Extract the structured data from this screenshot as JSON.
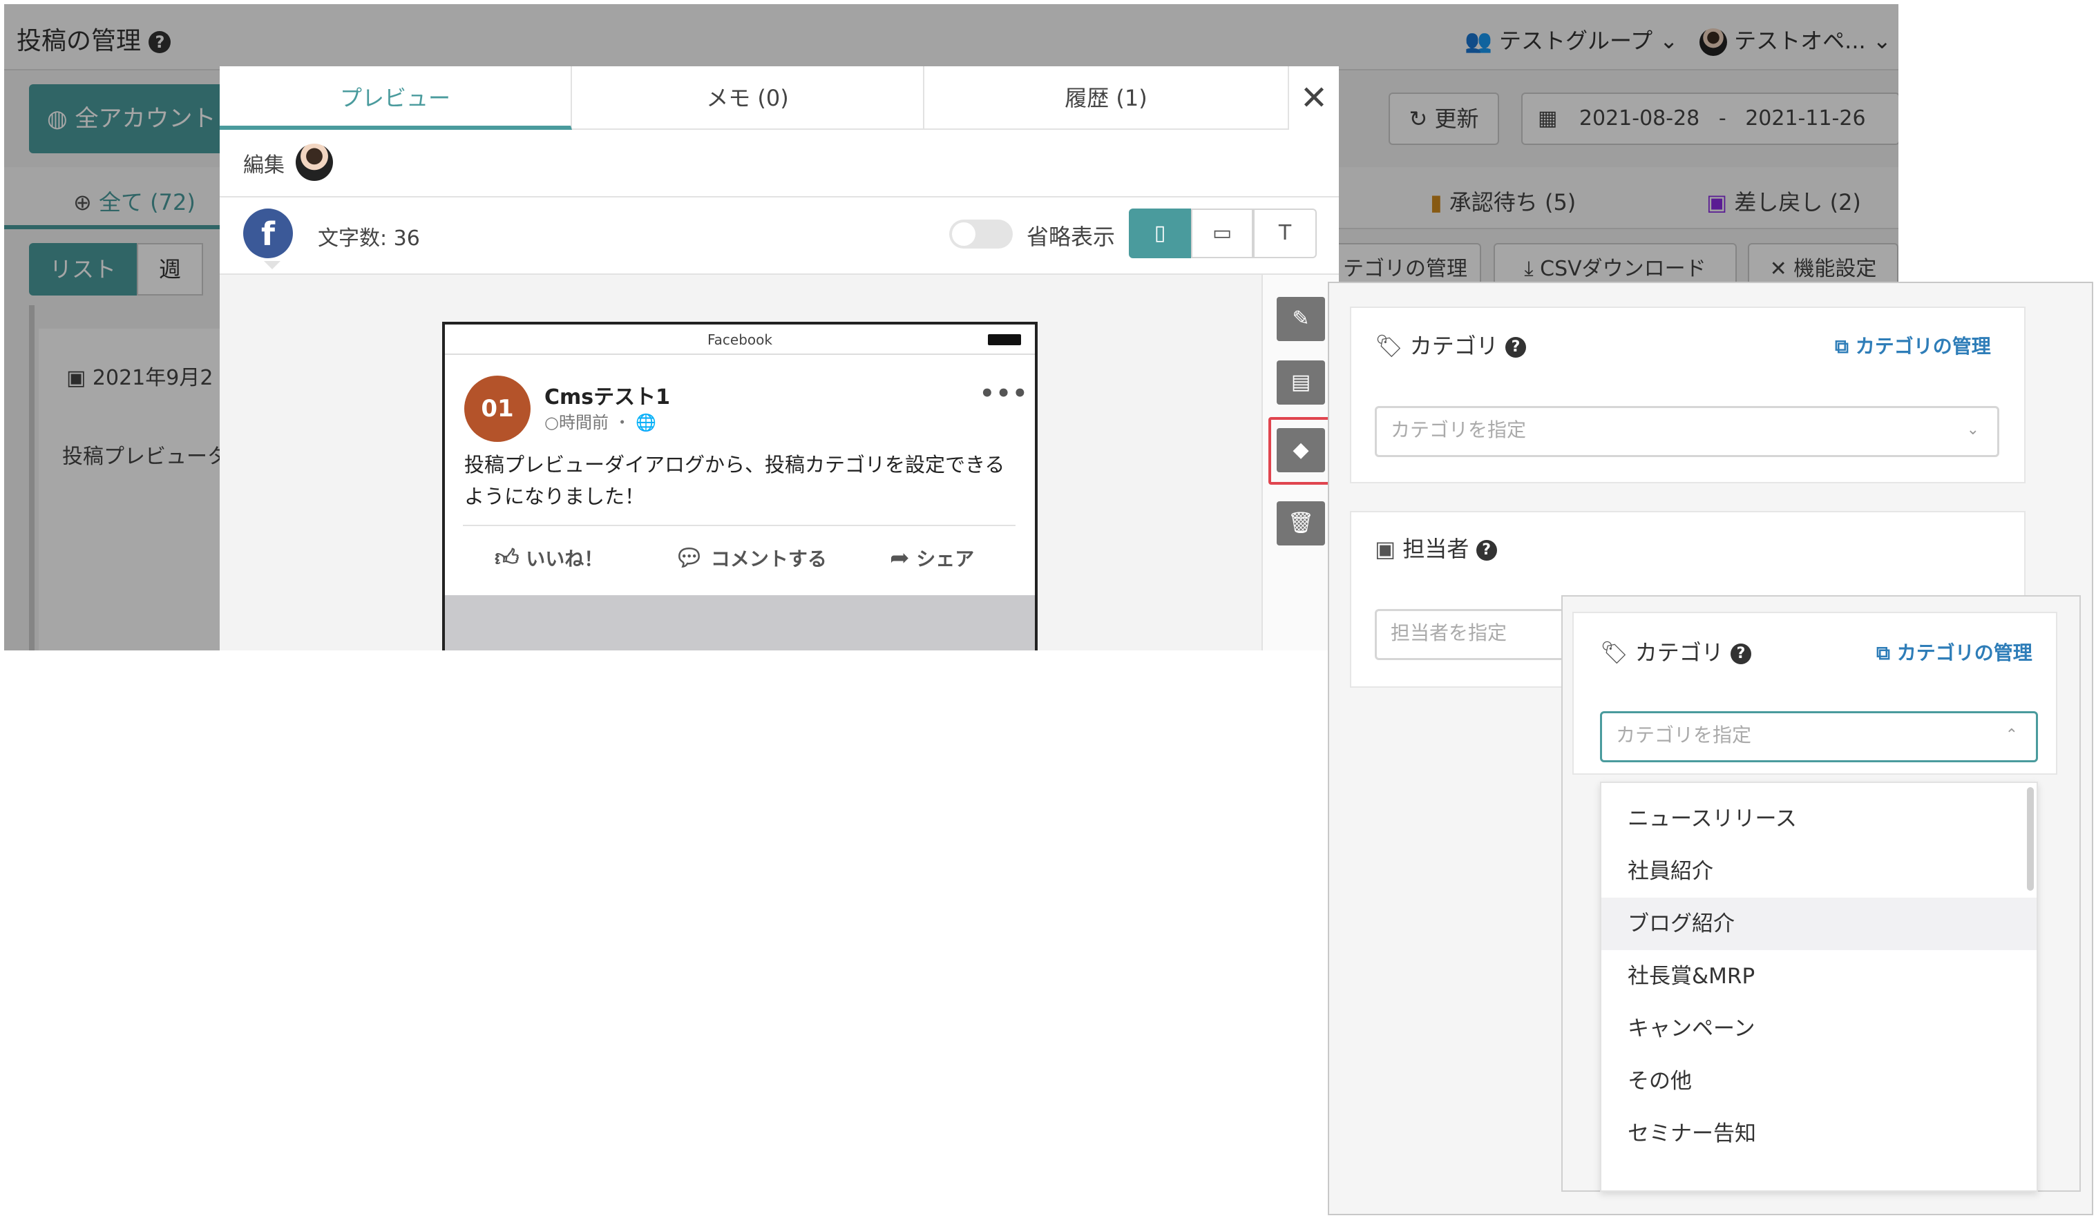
{
  "app": {
    "title": "投稿の管理",
    "group": "テストグループ",
    "user": "テストオペ...",
    "account_button": "全アカウント",
    "refresh": "更新",
    "date_from": "2021-08-28",
    "date_sep": "-",
    "date_to": "2021-11-26",
    "tab_all": "全て (72)",
    "tab_waiting": "承認待ち (5)",
    "tab_returned": "差し戻し (2)",
    "view_list": "リスト",
    "view_week": "週",
    "btn_category_manage": "テゴリの管理",
    "btn_csv": "CSVダウンロード",
    "btn_settings": "機能設定",
    "card_date": "2021年9月2",
    "card_text": "投稿プレビュータ"
  },
  "modal": {
    "tabs": [
      {
        "label": "プレビュー",
        "active": true
      },
      {
        "label": "メモ (0)",
        "active": false
      },
      {
        "label": "履歴 (1)",
        "active": false
      }
    ],
    "close": "✕",
    "edit_label": "編集",
    "char_count": "文字数: 36",
    "abbr_label": "省略表示",
    "view_text_button": "T",
    "phone": {
      "status_title": "Facebook",
      "logo_text": "01",
      "page_name": "Cmsテスト1",
      "time": "○時間前 ・",
      "more": "•••",
      "post_text": "投稿プレビューダイアログから、投稿カテゴリを設定できるようになりました！",
      "like": "いいね！",
      "comment": "コメントする",
      "share": "シェア"
    }
  },
  "panel": {
    "category_label": "カテゴリ",
    "category_manage_link": "カテゴリの管理",
    "category_placeholder": "カテゴリを指定",
    "assignee_label": "担当者",
    "assignee_placeholder": "担当者を指定"
  },
  "panel2": {
    "category_label": "カテゴリ",
    "category_manage_link": "カテゴリの管理",
    "category_placeholder": "カテゴリを指定",
    "options": [
      "ニュースリリース",
      "社員紹介",
      "ブログ紹介",
      "社長賞&MRP",
      "キャンペーン",
      "その他",
      "セミナー告知"
    ],
    "hover_index": 2
  },
  "colors": {
    "accent": "#4a9b9d",
    "facebook": "#3b5998",
    "link": "#2e7db8",
    "highlight": "#e0454f"
  }
}
